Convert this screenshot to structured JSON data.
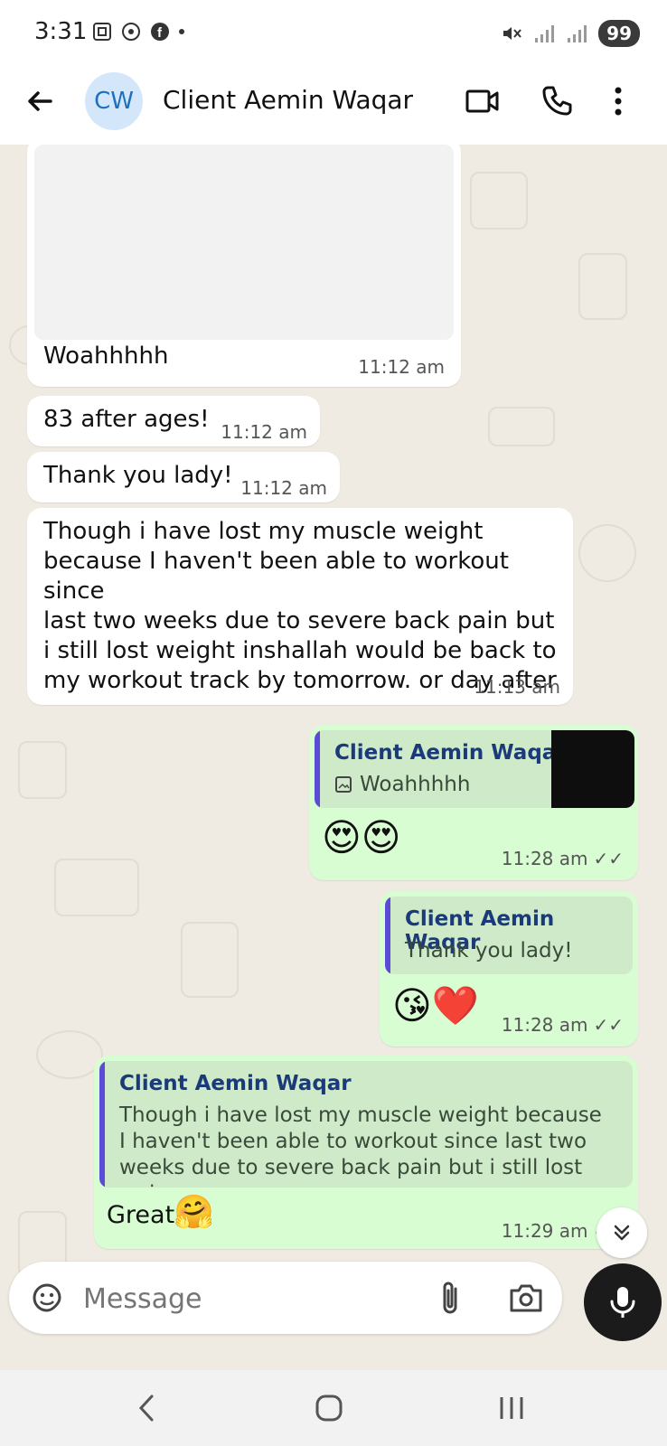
{
  "status_bar": {
    "time": "3:31",
    "battery": "99"
  },
  "header": {
    "avatar_initials": "CW",
    "title": "Client Aemin Waqar"
  },
  "messages": [
    {
      "direction": "in",
      "text": "Woahhhhh",
      "time": "11:12 am",
      "has_image": true
    },
    {
      "direction": "in",
      "text": "83 after ages!",
      "time": "11:12 am"
    },
    {
      "direction": "in",
      "text": "Thank you lady!",
      "time": "11:12 am"
    },
    {
      "direction": "in",
      "lines": [
        "Though i have lost my muscle weight",
        "because I haven't been able to workout since",
        "last two weeks due to severe back pain but",
        "i still lost weight inshallah would be back to",
        "my workout track by tomorrow. or day after"
      ],
      "time": "11:13 am"
    },
    {
      "direction": "out",
      "quote_name": "Client Aemin Waqar",
      "quote_text": "Woahhhhh",
      "text": "😍😍",
      "time": "11:28 am",
      "read": true
    },
    {
      "direction": "out",
      "quote_name": "Client Aemin Waqar",
      "quote_text": "Thank you lady!",
      "text": "😘❤️",
      "time": "11:28 am",
      "read": true
    },
    {
      "direction": "out",
      "quote_name": "Client Aemin Waqar",
      "quote_lines": [
        "Though i have lost my muscle weight because",
        "I haven't been able to workout since last two",
        "weeks due to severe back pain but i still lost wei…"
      ],
      "text": "Great",
      "emoji": "🤗",
      "time": "11:29 am",
      "read": true
    }
  ],
  "input": {
    "placeholder": "Message"
  },
  "icons": {
    "back": "arrow-left-icon",
    "video": "video-camera-icon",
    "call": "phone-icon",
    "menu": "more-vertical-icon",
    "sticker": "sticker-icon",
    "attach": "paperclip-icon",
    "camera": "camera-icon",
    "mic": "microphone-icon",
    "scroll": "double-chevron-down-icon"
  },
  "colors": {
    "incoming": "#ffffff",
    "outgoing": "#d8fdd2",
    "quote_bar": "#5b4bd6",
    "chat_bg": "#efeae2"
  }
}
